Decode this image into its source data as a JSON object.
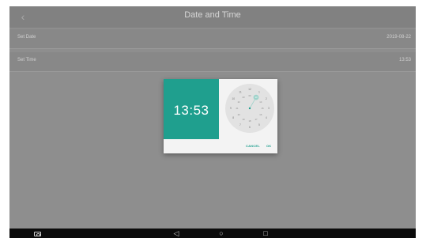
{
  "appbar": {
    "title": "Date and Time",
    "back_glyph": "‹"
  },
  "settings": [
    {
      "label": "Set Date",
      "value": "2019-08-22"
    },
    {
      "label": "Set Time",
      "value": "13:53"
    }
  ],
  "dialog": {
    "time": "13:53",
    "cancel_label": "CANCEL",
    "ok_label": "OK",
    "selected_hour": "13",
    "outer_hours": [
      "12",
      "1",
      "2",
      "3",
      "4",
      "5",
      "6",
      "7",
      "8",
      "9",
      "10",
      "11"
    ],
    "inner_hours": [
      "00",
      "13",
      "14",
      "15",
      "16",
      "17",
      "18",
      "19",
      "20",
      "21",
      "22",
      "23"
    ]
  },
  "navbar": {
    "back_glyph": "◁",
    "home_glyph": "○",
    "recent_glyph": "□"
  },
  "colors": {
    "accent": "#1f9f8e",
    "overlay": "#8e8e8e",
    "dialog_bg": "#f3f3f3"
  }
}
